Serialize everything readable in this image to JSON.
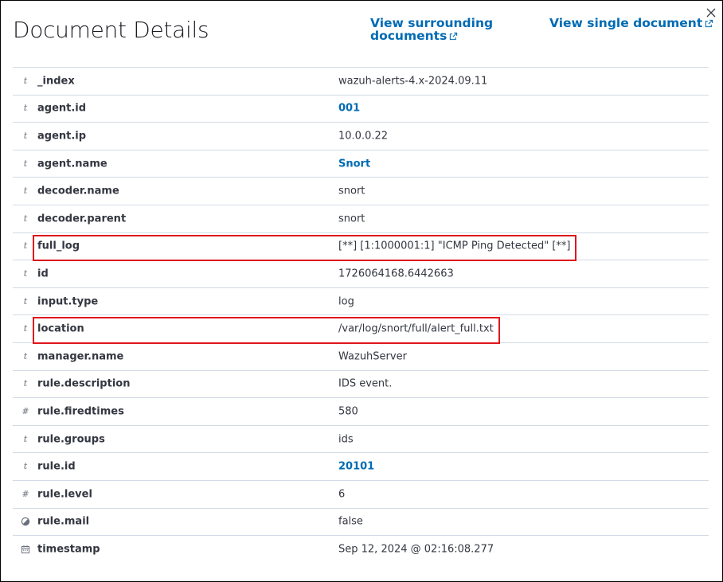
{
  "header": {
    "title": "Document Details",
    "view_surrounding_label": "View surrounding documents",
    "view_single_label": "View single document",
    "close_icon": "close-icon",
    "external_icon": "external-link-icon"
  },
  "colors": {
    "link": "#006bb4",
    "highlight": "#e0161b",
    "border": "#d3dae6"
  },
  "rows": [
    {
      "type": "t",
      "field": "_index",
      "value": "wazuh-alerts-4.x-2024.09.11",
      "link": false
    },
    {
      "type": "t",
      "field": "agent.id",
      "value": "001",
      "link": true
    },
    {
      "type": "t",
      "field": "agent.ip",
      "value": "10.0.0.22",
      "link": false
    },
    {
      "type": "t",
      "field": "agent.name",
      "value": "Snort",
      "link": true
    },
    {
      "type": "t",
      "field": "decoder.name",
      "value": "snort",
      "link": false
    },
    {
      "type": "t",
      "field": "decoder.parent",
      "value": "snort",
      "link": false
    },
    {
      "type": "t",
      "field": "full_log",
      "value": "[**] [1:1000001:1] \"ICMP Ping Detected\" [**]",
      "link": false,
      "highlighted": true
    },
    {
      "type": "t",
      "field": "id",
      "value": "1726064168.6442663",
      "link": false
    },
    {
      "type": "t",
      "field": "input.type",
      "value": "log",
      "link": false
    },
    {
      "type": "t",
      "field": "location",
      "value": "/var/log/snort/full/alert_full.txt",
      "link": false,
      "highlighted": true
    },
    {
      "type": "t",
      "field": "manager.name",
      "value": "WazuhServer",
      "link": false
    },
    {
      "type": "t",
      "field": "rule.description",
      "value": "IDS event.",
      "link": false
    },
    {
      "type": "#",
      "field": "rule.firedtimes",
      "value": "580",
      "link": false
    },
    {
      "type": "t",
      "field": "rule.groups",
      "value": "ids",
      "link": false
    },
    {
      "type": "t",
      "field": "rule.id",
      "value": "20101",
      "link": true
    },
    {
      "type": "#",
      "field": "rule.level",
      "value": "6",
      "link": false
    },
    {
      "type": "boolean",
      "field": "rule.mail",
      "value": "false",
      "link": false
    },
    {
      "type": "date",
      "field": "timestamp",
      "value": "Sep 12, 2024 @ 02:16:08.277",
      "link": false
    }
  ]
}
